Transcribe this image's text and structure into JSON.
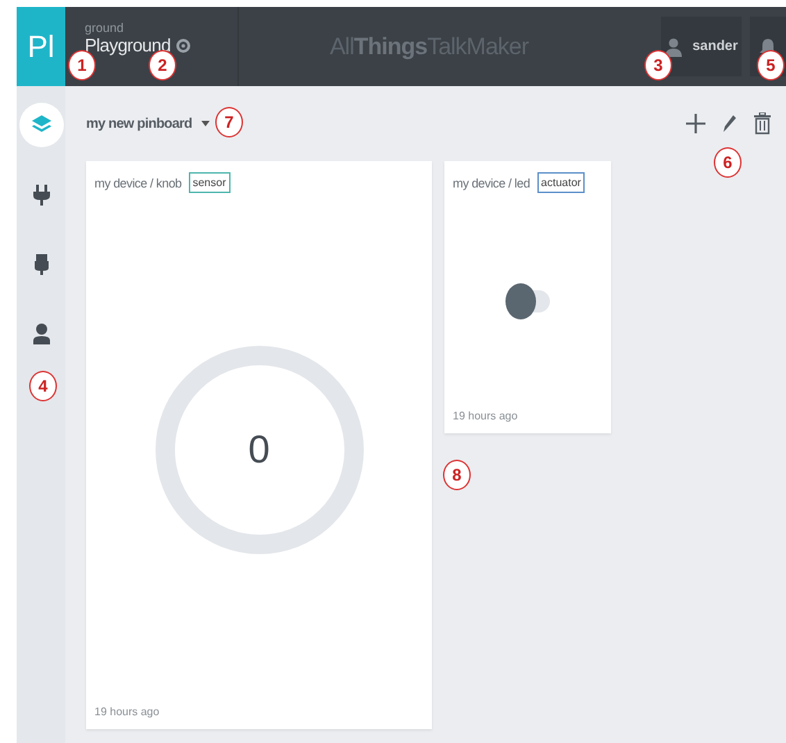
{
  "topbar": {
    "logo": "Pl",
    "workspace_label": "ground",
    "workspace": "Playground",
    "brand": "All**Things**TalkMaker",
    "user": "sander"
  },
  "sidebar": {
    "items": [
      {
        "kind": "layers",
        "selected": true
      },
      {
        "kind": "plug",
        "selected": false
      },
      {
        "kind": "usb",
        "selected": false
      },
      {
        "kind": "person",
        "selected": false
      }
    ]
  },
  "pinboard": {
    "title": "my new pinboard"
  },
  "cards": [
    {
      "kind": "knob",
      "title": "my device / knob",
      "tag": "sensor",
      "color": "#4db6ac",
      "value": "0",
      "time": "19 hours ago"
    },
    {
      "kind": "toggle",
      "title": "my device / led",
      "tag": "actuator",
      "color": "#5b8fc9",
      "on": false,
      "time": "19 hours ago"
    }
  ],
  "callouts": [
    {
      "number": "1"
    },
    {
      "number": "2"
    },
    {
      "number": "3"
    },
    {
      "number": "4"
    },
    {
      "number": "5"
    },
    {
      "number": "6"
    },
    {
      "number": "7"
    },
    {
      "number": "8"
    }
  ]
}
